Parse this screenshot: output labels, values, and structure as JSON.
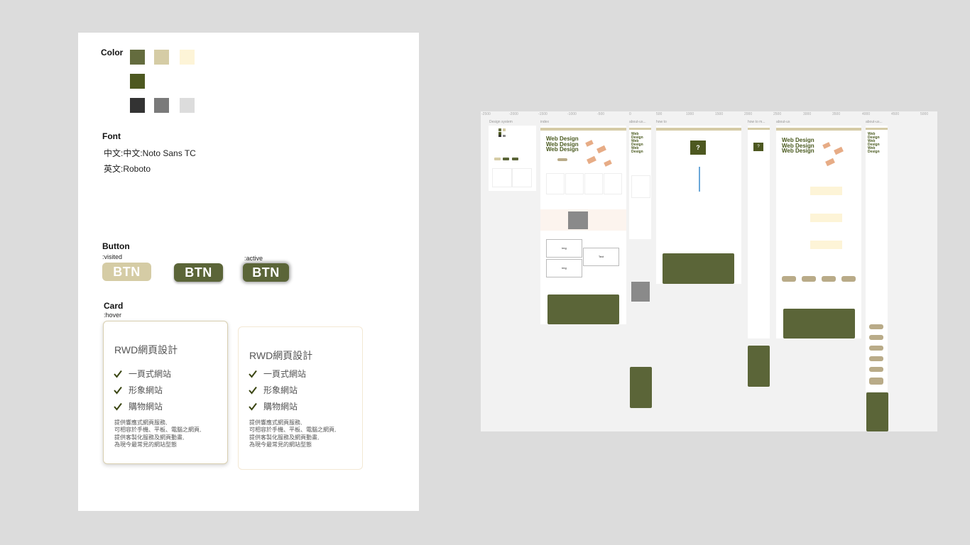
{
  "design_system": {
    "color": {
      "title": "Color",
      "swatches_row1": [
        "#646c3e",
        "#d5cca5",
        "#fdf4d7"
      ],
      "swatches_row2": [
        "#4d5820"
      ],
      "swatches_row3": [
        "#333333",
        "#7a7a7a",
        "#dcdcdc"
      ]
    },
    "font": {
      "title": "Font",
      "line1": "中文:中文:Noto Sans TC",
      "line2": "英文:Roboto"
    },
    "button": {
      "title": "Button",
      "state_visited": ":visited",
      "state_active": ":active",
      "label": "BTN",
      "colors": {
        "visited": "#d5cca5",
        "normal": "#5b6538",
        "active": "#5b6538"
      }
    },
    "card": {
      "title": "Card",
      "state_hover": ":hover",
      "heading": "RWD網頁設計",
      "items": [
        "一頁式網站",
        "形象網站",
        "購物網站"
      ],
      "desc_lines": [
        "提供響應式網頁服務,",
        "可相容於手機、平板、電腦之網頁,",
        "提供客製化服務及網頁動畫,",
        "為現今最常見的網站型態"
      ],
      "check_color": "#3a4512"
    }
  },
  "overview": {
    "ruler_labels": [
      "-2500",
      "-2000",
      "-1500",
      "-1000",
      "-500",
      "0",
      "500",
      "1000",
      "1500",
      "2000",
      "2500",
      "3000",
      "3500",
      "4000",
      "4500",
      "5000"
    ],
    "frame_labels": [
      "Design system",
      "index",
      "about-us...",
      "how to",
      "how to m...",
      "about-us",
      "about-us..."
    ],
    "hero_text": "Web Design",
    "img_label": "img",
    "text_label": "Text",
    "question_mark": "?"
  }
}
